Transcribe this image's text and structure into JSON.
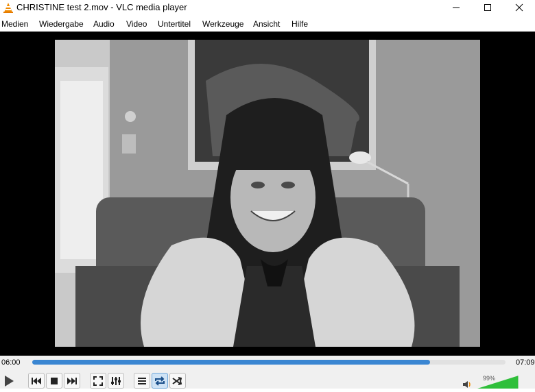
{
  "window": {
    "title": "CHRISTINE test 2.mov - VLC media player"
  },
  "menu": [
    "Medien",
    "Wiedergabe",
    "Audio",
    "Video",
    "Untertitel",
    "Werkzeuge",
    "Ansicht",
    "Hilfe"
  ],
  "player": {
    "elapsed": "06:00",
    "total": "07:09",
    "progress_fraction": 0.84,
    "volume_label": "99%",
    "volume_fraction": 0.99
  },
  "colors": {
    "accent": "#3a86d2",
    "volume": "#2fbf3a",
    "vlc_orange": "#f08a00"
  },
  "icons": [
    "vlc-logo-icon",
    "minimize-icon",
    "maximize-icon",
    "close-icon",
    "play-icon",
    "previous-icon",
    "stop-icon",
    "next-icon",
    "fullscreen-icon",
    "extended-settings-icon",
    "playlist-icon",
    "loop-icon",
    "shuffle-icon",
    "speaker-icon"
  ]
}
